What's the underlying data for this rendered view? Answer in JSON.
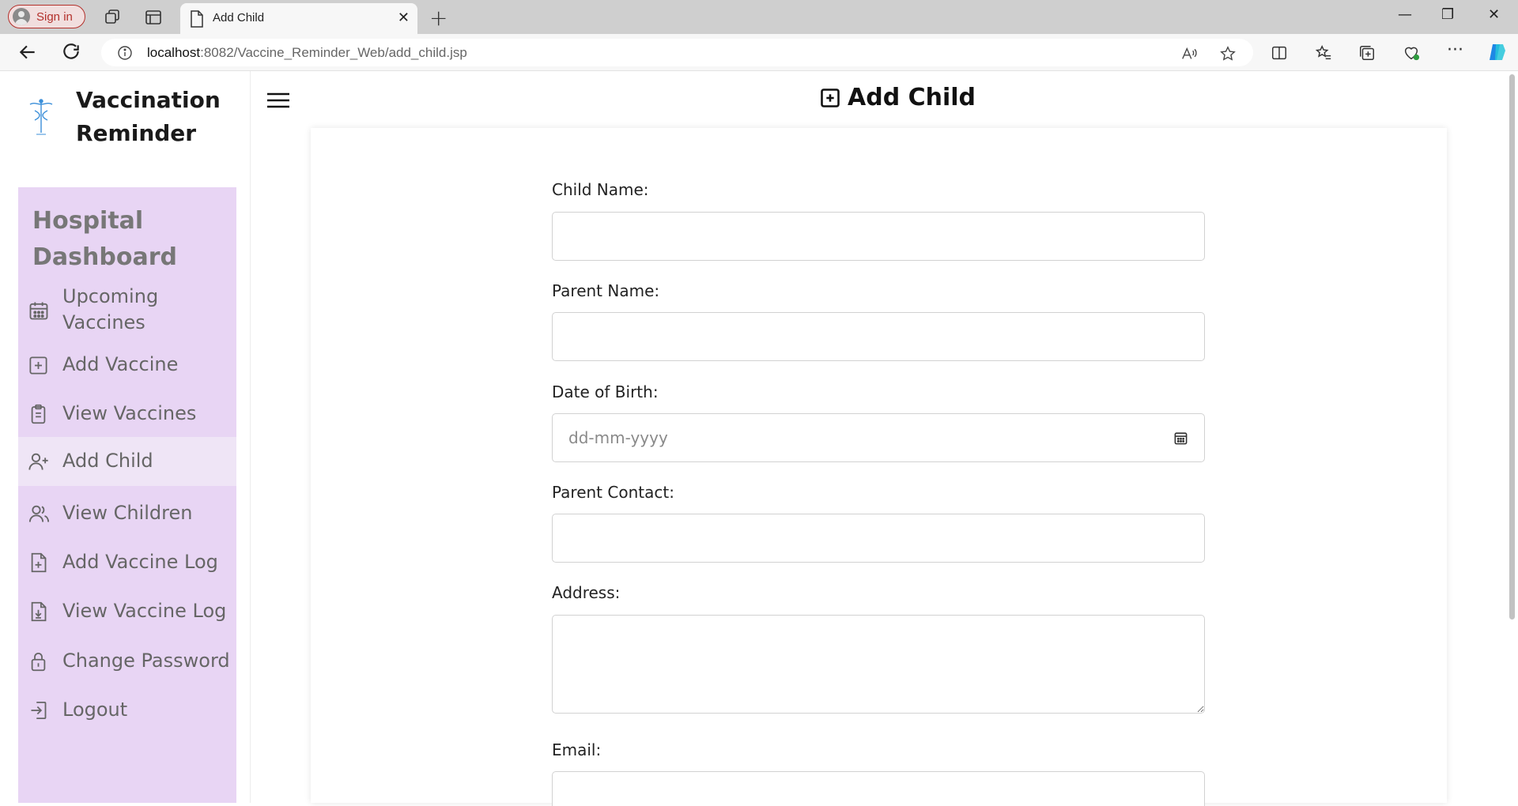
{
  "browser": {
    "signin_label": "Sign in",
    "tab_title": "Add Child",
    "tab_close": "✕",
    "new_tab": "+",
    "url_host": "localhost",
    "url_rest": ":8082/Vaccine_Reminder_Web/add_child.jsp",
    "window_controls": {
      "minimize": "—",
      "restore": "❐",
      "close": "✕"
    }
  },
  "brand": {
    "name": "Vaccination Reminder"
  },
  "sidebar": {
    "section_title": "Hospital Dashboard",
    "items": [
      {
        "label": "Upcoming Vaccines",
        "icon": "calendar-icon"
      },
      {
        "label": "Add Vaccine",
        "icon": "plus-square-icon"
      },
      {
        "label": "View Vaccines",
        "icon": "clipboard-icon"
      },
      {
        "label": "Add Child",
        "icon": "user-plus-icon",
        "active": true
      },
      {
        "label": "View Children",
        "icon": "users-icon"
      },
      {
        "label": "Add Vaccine Log",
        "icon": "file-plus-icon"
      },
      {
        "label": "View Vaccine Log",
        "icon": "file-download-icon"
      },
      {
        "label": "Change Password",
        "icon": "lock-icon"
      },
      {
        "label": "Logout",
        "icon": "logout-icon"
      }
    ]
  },
  "header": {
    "title": "Add Child"
  },
  "form": {
    "child_name": {
      "label": "Child Name:",
      "value": ""
    },
    "parent_name": {
      "label": "Parent Name:",
      "value": ""
    },
    "dob": {
      "label": "Date of Birth:",
      "placeholder": "dd-mm-yyyy"
    },
    "parent_contact": {
      "label": "Parent Contact:",
      "value": ""
    },
    "address": {
      "label": "Address:",
      "value": ""
    },
    "email": {
      "label": "Email:",
      "value": ""
    }
  },
  "colors": {
    "sidebar_bg": "#e8d5f4",
    "sidebar_active": "#efe5f6",
    "signin_accent": "#b3312c"
  }
}
